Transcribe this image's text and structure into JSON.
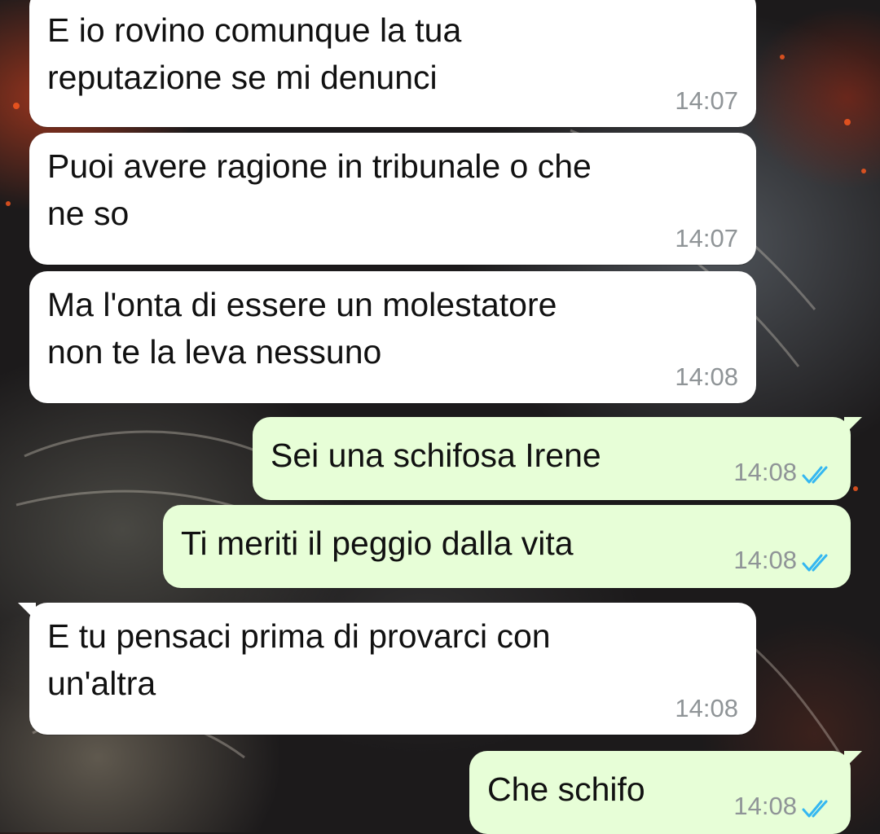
{
  "colors": {
    "incoming_bubble": "#ffffff",
    "outgoing_bubble": "#e7fed7",
    "time": "#8f9497",
    "read_ticks": "#34b7f1"
  },
  "messages": [
    {
      "direction": "incoming",
      "line1": "E io rovino comunque la tua",
      "line2": "reputazione se mi denunci",
      "time": "14:07"
    },
    {
      "direction": "incoming",
      "line1": "Puoi avere ragione in tribunale o che",
      "line2": "ne so",
      "time": "14:07"
    },
    {
      "direction": "incoming",
      "line1": "Ma l'onta di essere un molestatore",
      "line2": "non te la leva nessuno",
      "time": "14:08"
    },
    {
      "direction": "outgoing",
      "line1": "Sei una schifosa Irene",
      "time": "14:08",
      "status_icon": "double-check-read-icon"
    },
    {
      "direction": "outgoing",
      "line1": "Ti meriti il peggio dalla vita",
      "time": "14:08",
      "status_icon": "double-check-read-icon"
    },
    {
      "direction": "incoming",
      "line1": "E tu pensaci prima di provarci con",
      "line2": "un'altra",
      "time": "14:08"
    },
    {
      "direction": "outgoing",
      "line1": "Che schifo",
      "time": "14:08",
      "status_icon": "double-check-read-icon"
    }
  ]
}
